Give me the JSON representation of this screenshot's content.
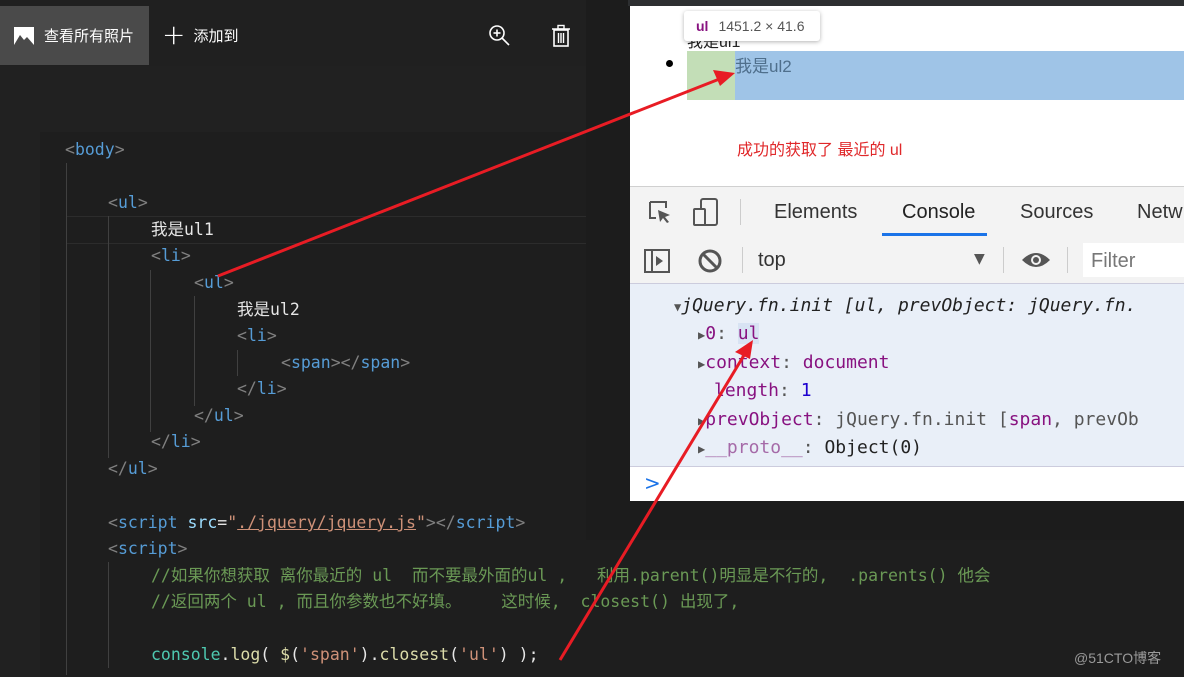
{
  "photos_toolbar": {
    "view_all_label": "查看所有照片",
    "add_to_label": "添加到",
    "icons": {
      "view_all": "image-icon",
      "add": "plus-icon",
      "zoom": "zoom-in-icon",
      "delete": "trash-icon"
    }
  },
  "editor": {
    "lines": {
      "body_open": "body",
      "ul_open": "ul",
      "ul1_text": "我是ul1",
      "li_open": "li",
      "ul_inner_open": "ul",
      "ul2_text": "我是ul2",
      "li_inner_open": "li",
      "span_tag": "span",
      "li_inner_close": "li",
      "ul_inner_close": "ul",
      "li_close": "li",
      "ul_close": "ul",
      "script_src_tag": "script",
      "script_src_attr": "src",
      "script_src_value": "./jquery/jquery.js",
      "script_open": "script",
      "comment1": "//如果你想获取 离你最近的 ul  而不要最外面的ul ,   利用.parent()明显是不行的,  .parents() 他会",
      "comment2": "//返回两个 ul , 而且你参数也不好填。    这时候,  closest() 出现了,",
      "console_obj": "console",
      "console_fn": "log",
      "selector_str": "'span'",
      "closest_fn": "closest",
      "closest_arg": "'ul'"
    }
  },
  "browser_page": {
    "ul1_text": "我是ul1",
    "ul2_text": "我是ul2",
    "tooltip_tag": "ul",
    "tooltip_size": "1451.2 × 41.6",
    "annotation": "成功的获取了 最近的 ul"
  },
  "devtools": {
    "tabs": [
      {
        "label": "Elements",
        "active": false
      },
      {
        "label": "Console",
        "active": true
      },
      {
        "label": "Sources",
        "active": false
      },
      {
        "label": "Netw",
        "active": false
      }
    ],
    "context": "top",
    "filter_placeholder": "Filter",
    "accent_color": "#1a73e8",
    "console": {
      "summary": "jQuery.fn.init [ul, prevObject: jQuery.fn.",
      "item0_key": "0",
      "item0_val": "ul",
      "context_key": "context",
      "context_val": "document",
      "length_key": "length",
      "length_val": "1",
      "prev_key": "prevObject",
      "prev_val_a": "jQuery.fn.init [",
      "prev_val_b": "span",
      "prev_val_c": ", prevOb",
      "proto_key": "__proto__",
      "proto_val": "Object(0)"
    },
    "prompt": ">"
  },
  "annotation_color": "#e0282a",
  "watermark": "@51CTO博客"
}
